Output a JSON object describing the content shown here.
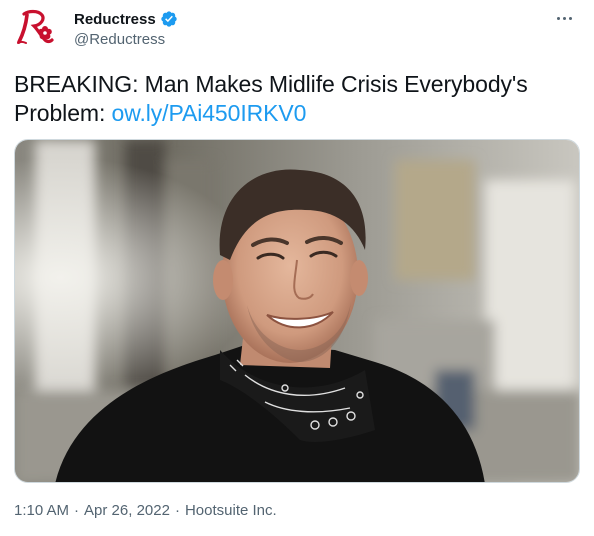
{
  "tweet": {
    "display_name": "Reductress",
    "handle": "@Reductress",
    "text": "BREAKING: Man Makes Midlife Crisis Everybody's Problem: ",
    "link": "ow.ly/PAi450IRKV0",
    "time": "1:10 AM",
    "date": "Apr 26, 2022",
    "source": "Hootsuite Inc.",
    "separator": "·"
  },
  "icons": {
    "avatar": "reductress-logo",
    "verified": "verified-badge-icon",
    "more": "more-options-icon"
  },
  "colors": {
    "link": "#1d9bf0",
    "verified": "#1d9bf0",
    "logo": "#c8102e",
    "secondary_text": "#536471"
  },
  "media": {
    "subject": "man-in-black-jacket-and-bandana"
  }
}
